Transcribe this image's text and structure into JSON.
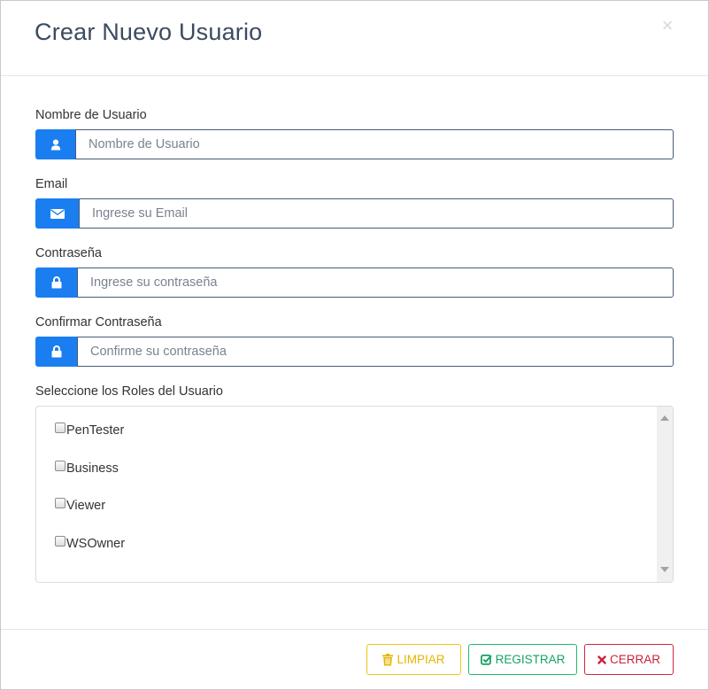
{
  "modal": {
    "title": "Crear Nuevo Usuario",
    "close_symbol": "×"
  },
  "form": {
    "username": {
      "label": "Nombre de Usuario",
      "placeholder": "Nombre de Usuario",
      "value": "",
      "icon": "user-icon"
    },
    "email": {
      "label": "Email",
      "placeholder": "Ingrese su Email",
      "value": "",
      "icon": "envelope-icon"
    },
    "password": {
      "label": "Contraseña",
      "placeholder": "Ingrese su contraseña",
      "value": "",
      "icon": "lock-icon"
    },
    "confirm_password": {
      "label": "Confirmar Contraseña",
      "placeholder": "Confirme su contraseña",
      "value": "",
      "icon": "lock-icon"
    }
  },
  "roles": {
    "label": "Seleccione los Roles del Usuario",
    "items": [
      {
        "label": "PenTester",
        "checked": false
      },
      {
        "label": "Business",
        "checked": false
      },
      {
        "label": "Viewer",
        "checked": false
      },
      {
        "label": "WSOwner",
        "checked": false
      }
    ]
  },
  "footer": {
    "clear_label": "LIMPIAR",
    "register_label": "REGISTRAR",
    "close_label": "CERRAR"
  },
  "colors": {
    "addon_blue": "#1a7ef0",
    "warning_yellow": "#f0c419",
    "success_green": "#1fba6e",
    "danger_red": "#d1263f",
    "title": "#3b4b60"
  }
}
